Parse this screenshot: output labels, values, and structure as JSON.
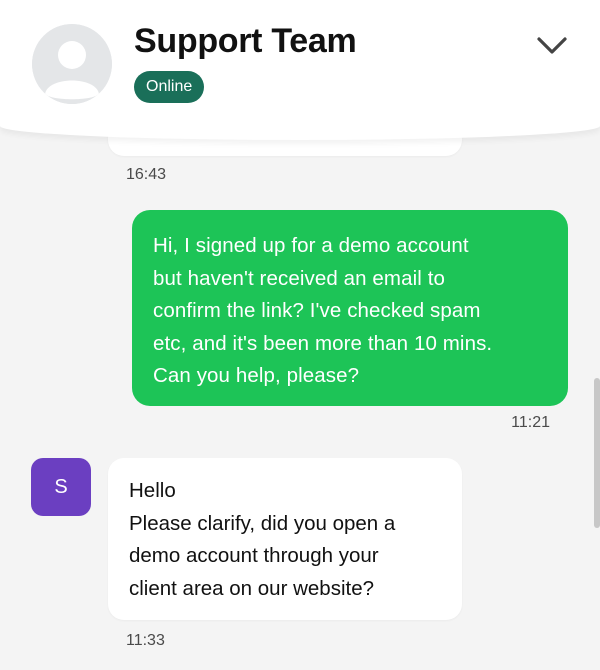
{
  "header": {
    "title": "Support Team",
    "status": "Online",
    "avatar_icon": "user-placeholder-icon",
    "collapse_icon": "chevron-down-icon"
  },
  "messages": [
    {
      "sender": "agent",
      "text": "",
      "time": "16:43"
    },
    {
      "sender": "user",
      "lines": [
        "Hi, I signed up for a demo account",
        "but haven't received an email to",
        "confirm the link? I've checked spam",
        "etc, and it's been more than 10 mins.",
        "Can you help, please?"
      ],
      "time": "11:21"
    },
    {
      "sender": "agent",
      "avatar_letter": "S",
      "lines": [
        "Hello",
        "Please clarify, did you open a",
        "demo account through your",
        "client area on our website?"
      ],
      "time": "11:33"
    }
  ],
  "colors": {
    "outgoing_bubble": "#1dc457",
    "status_badge": "#1a6f59",
    "agent_avatar": "#6b3fc1",
    "background": "#f4f4f4"
  }
}
